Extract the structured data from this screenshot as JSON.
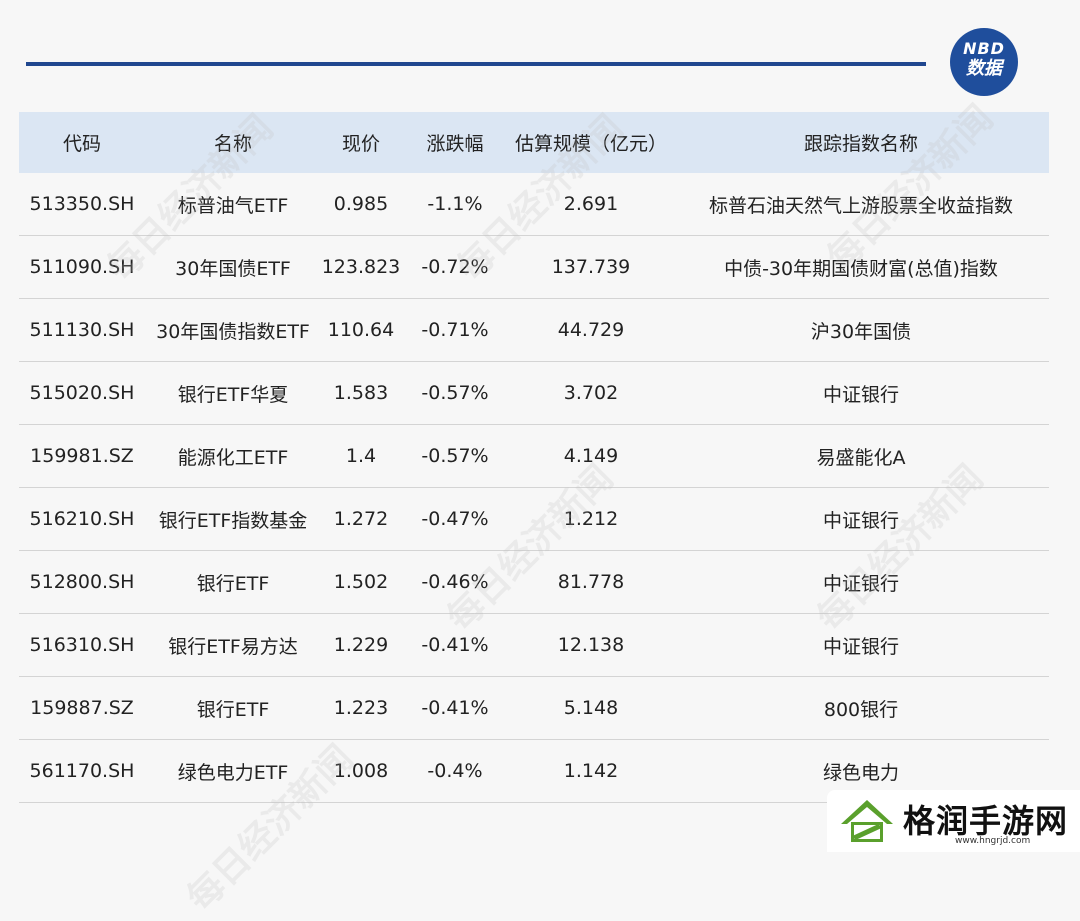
{
  "badge": {
    "line1": "NBD",
    "line2": "数据"
  },
  "table": {
    "headers": [
      "代码",
      "名称",
      "现价",
      "涨跌幅",
      "估算规模（亿元）",
      "跟踪指数名称"
    ],
    "rows": [
      [
        "513350.SH",
        "标普油气ETF",
        "0.985",
        "-1.1%",
        "2.691",
        "标普石油天然气上游股票全收益指数"
      ],
      [
        "511090.SH",
        "30年国债ETF",
        "123.823",
        "-0.72%",
        "137.739",
        "中债-30年期国债财富(总值)指数"
      ],
      [
        "511130.SH",
        "30年国债指数ETF",
        "110.64",
        "-0.71%",
        "44.729",
        "沪30年国债"
      ],
      [
        "515020.SH",
        "银行ETF华夏",
        "1.583",
        "-0.57%",
        "3.702",
        "中证银行"
      ],
      [
        "159981.SZ",
        "能源化工ETF",
        "1.4",
        "-0.57%",
        "4.149",
        "易盛能化A"
      ],
      [
        "516210.SH",
        "银行ETF指数基金",
        "1.272",
        "-0.47%",
        "1.212",
        "中证银行"
      ],
      [
        "512800.SH",
        "银行ETF",
        "1.502",
        "-0.46%",
        "81.778",
        "中证银行"
      ],
      [
        "516310.SH",
        "银行ETF易方达",
        "1.229",
        "-0.41%",
        "12.138",
        "中证银行"
      ],
      [
        "159887.SZ",
        "银行ETF",
        "1.223",
        "-0.41%",
        "5.148",
        "800银行"
      ],
      [
        "561170.SH",
        "绿色电力ETF",
        "1.008",
        "-0.4%",
        "1.142",
        "绿色电力"
      ]
    ]
  },
  "watermark": "每日经济新闻",
  "game_badge": {
    "title": "格润手游网",
    "url": "www.hngrjd.com"
  },
  "colors": {
    "rule": "#20478f",
    "header_bg": "#dbe6f3",
    "badge_blue": "#1f4e9c",
    "game_green": "#5aa02c"
  }
}
